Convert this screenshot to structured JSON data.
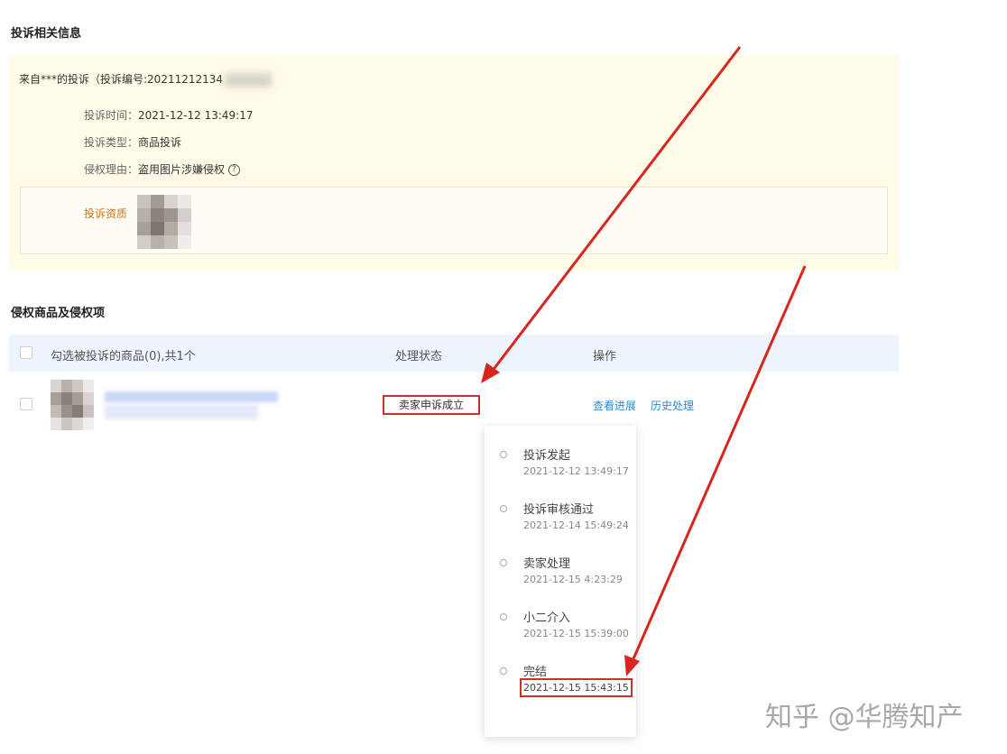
{
  "complaint_section": {
    "title": "投诉相关信息",
    "from_text": "来自***的投诉（投诉编号:20211212134",
    "rows": [
      {
        "label": "投诉时间：",
        "value": "2021-12-12 13:49:17"
      },
      {
        "label": "投诉类型：",
        "value": "商品投诉"
      },
      {
        "label": "侵权理由：",
        "value": "盗用图片涉嫌侵权"
      }
    ],
    "help_icon": "help-circle-icon",
    "qualification_label": "投诉资质"
  },
  "goods_section": {
    "title": "侵权商品及侵权项",
    "columns": {
      "select_label": "勾选被投诉的商品(0),共1个",
      "status": "处理状态",
      "actions": "操作"
    },
    "row": {
      "status": "卖家申诉成立",
      "actions": [
        "查看进展",
        "历史处理"
      ]
    }
  },
  "progress_popover": {
    "steps": [
      {
        "title": "投诉发起",
        "time": "2021-12-12 13:49:17"
      },
      {
        "title": "投诉审核通过",
        "time": "2021-12-14 15:49:24"
      },
      {
        "title": "卖家处理",
        "time": "2021-12-15 4:23:29"
      },
      {
        "title": "小二介入",
        "time": "2021-12-15 15:39:00"
      },
      {
        "title": "完结",
        "time": "2021-12-15 15:43:15"
      }
    ]
  },
  "watermark": "知乎 @华腾知产",
  "colors": {
    "annotation_red": "#d7261d",
    "link_blue": "#2e8bd0",
    "panel_yellow": "#fffbe8",
    "header_blue": "#eef4fb"
  }
}
